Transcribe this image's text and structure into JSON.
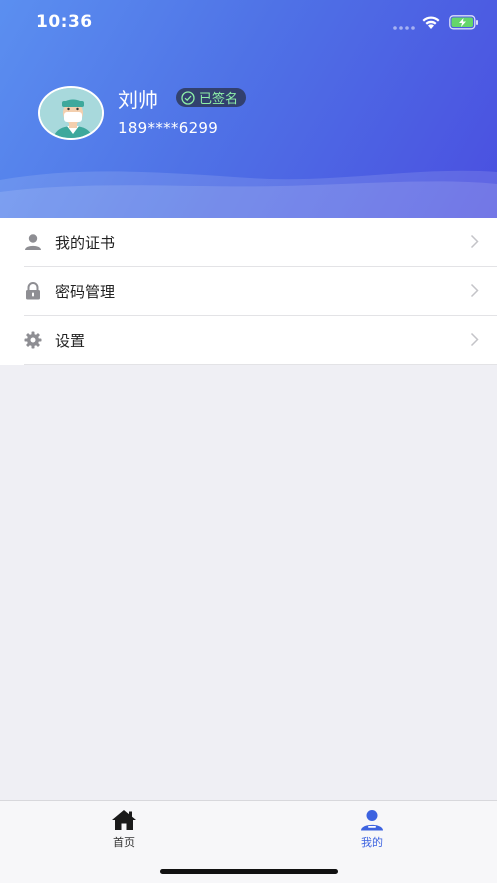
{
  "status_bar": {
    "time": "10:36"
  },
  "profile": {
    "name": "刘帅",
    "badge": "已签名",
    "phone": "189****6299"
  },
  "menu": {
    "items": [
      {
        "label": "我的证书",
        "icon": "user-icon"
      },
      {
        "label": "密码管理",
        "icon": "lock-icon"
      },
      {
        "label": "设置",
        "icon": "gear-icon"
      }
    ]
  },
  "tabbar": {
    "tabs": [
      {
        "label": "首页",
        "icon": "home-icon",
        "active": false
      },
      {
        "label": "我的",
        "icon": "user-icon",
        "active": true
      }
    ]
  },
  "colors": {
    "accent": "#3d63e0",
    "header_start": "#5b8ff0",
    "header_end": "#4a4fe0",
    "badge_text": "#8ef0a8"
  }
}
